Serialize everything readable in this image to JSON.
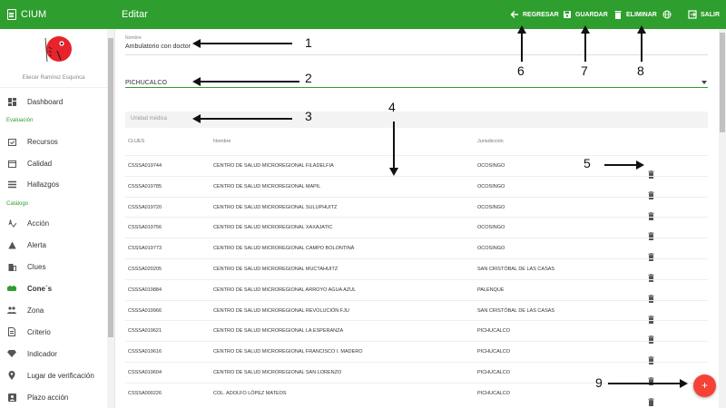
{
  "app": {
    "name": "CIUM",
    "page_title": "Editar"
  },
  "actions": {
    "back": "REGRESAR",
    "save": "GUARDAR",
    "delete": "ELIMINAR",
    "exit": "SALIR"
  },
  "sidebar": {
    "user": "Eliecer Ramírez Esquinca",
    "sections": {
      "evaluation": "Evaluación",
      "catalog": "Catálogo"
    },
    "items": [
      {
        "label": "Dashboard",
        "icon": "dashboard-icon"
      },
      {
        "label": "Recursos",
        "icon": "calendar-check-icon"
      },
      {
        "label": "Calidad",
        "icon": "calendar-icon"
      },
      {
        "label": "Hallazgos",
        "icon": "list-icon"
      },
      {
        "label": "Acción",
        "icon": "spellcheck-icon"
      },
      {
        "label": "Alerta",
        "icon": "warning-icon"
      },
      {
        "label": "Clues",
        "icon": "building-icon"
      },
      {
        "label": "Cone´s",
        "icon": "group-icon"
      },
      {
        "label": "Zona",
        "icon": "people-icon"
      },
      {
        "label": "Criterio",
        "icon": "document-icon"
      },
      {
        "label": "Indicador",
        "icon": "diamond-icon"
      },
      {
        "label": "Lugar de verificación",
        "icon": "place-icon"
      },
      {
        "label": "Plazo acción",
        "icon": "badge-icon"
      }
    ]
  },
  "form": {
    "name_label": "Nombre",
    "name_value": "Ambulatorio con doctor",
    "jurisdiction_value": "PICHUCALCO",
    "search_placeholder": "Unidad médica"
  },
  "table": {
    "headers": [
      "CLUES",
      "Nombre",
      "Jurisdicción"
    ],
    "rows": [
      [
        "CSSSA019744",
        "CENTRO DE SALUD MICROREGIONAL FILADELFIA",
        "OCOSINGO"
      ],
      [
        "CSSSA019785",
        "CENTRO DE SALUD MICROREGIONAL MAPIL",
        "OCOSINGO"
      ],
      [
        "CSSSA019720",
        "CENTRO DE SALUD MICROREGIONAL SULUPHUITZ",
        "OCOSINGO"
      ],
      [
        "CSSSA019756",
        "CENTRO DE SALUD MICROREGIONAL XAXAJATIC",
        "OCOSINGO"
      ],
      [
        "CSSSA019773",
        "CENTRO DE SALUD MICROREGIONAL CAMPO BOLONTINÁ",
        "OCOSINGO"
      ],
      [
        "CSSSA020205",
        "CENTRO DE SALUD MICROREGIONAL MUCTAHUITZ",
        "SAN CRISTÓBAL DE LAS CASAS"
      ],
      [
        "CSSSA019884",
        "CENTRO DE SALUD MICROREGIONAL ARROYO AGUA AZUL",
        "PALENQUE"
      ],
      [
        "CSSSA019966",
        "CENTRO DE SALUD MICROREGIONAL REVOLUCIÓN FJU",
        "SAN CRISTÓBAL DE LAS CASAS"
      ],
      [
        "CSSSA019621",
        "CENTRO DE SALUD MICROREGIONAL LA ESPERANZA",
        "PICHUCALCO"
      ],
      [
        "CSSSA019616",
        "CENTRO DE SALUD MICROREGIONAL FRANCISCO I. MADERO",
        "PICHUCALCO"
      ],
      [
        "CSSSA019604",
        "CENTRO DE SALUD MICROREGIONAL SAN LORENZO",
        "PICHUCALCO"
      ],
      [
        "CSSSA000226",
        "COL. ADOLFO LÓPEZ MATEOS",
        "PICHUCALCO"
      ]
    ]
  },
  "fab": {
    "label": "+"
  },
  "annotations": [
    "1",
    "2",
    "3",
    "4",
    "5",
    "6",
    "7",
    "8",
    "9"
  ],
  "colors": {
    "primary": "#2e9e2e",
    "fab": "#f44336",
    "logo": "#e8232b"
  }
}
